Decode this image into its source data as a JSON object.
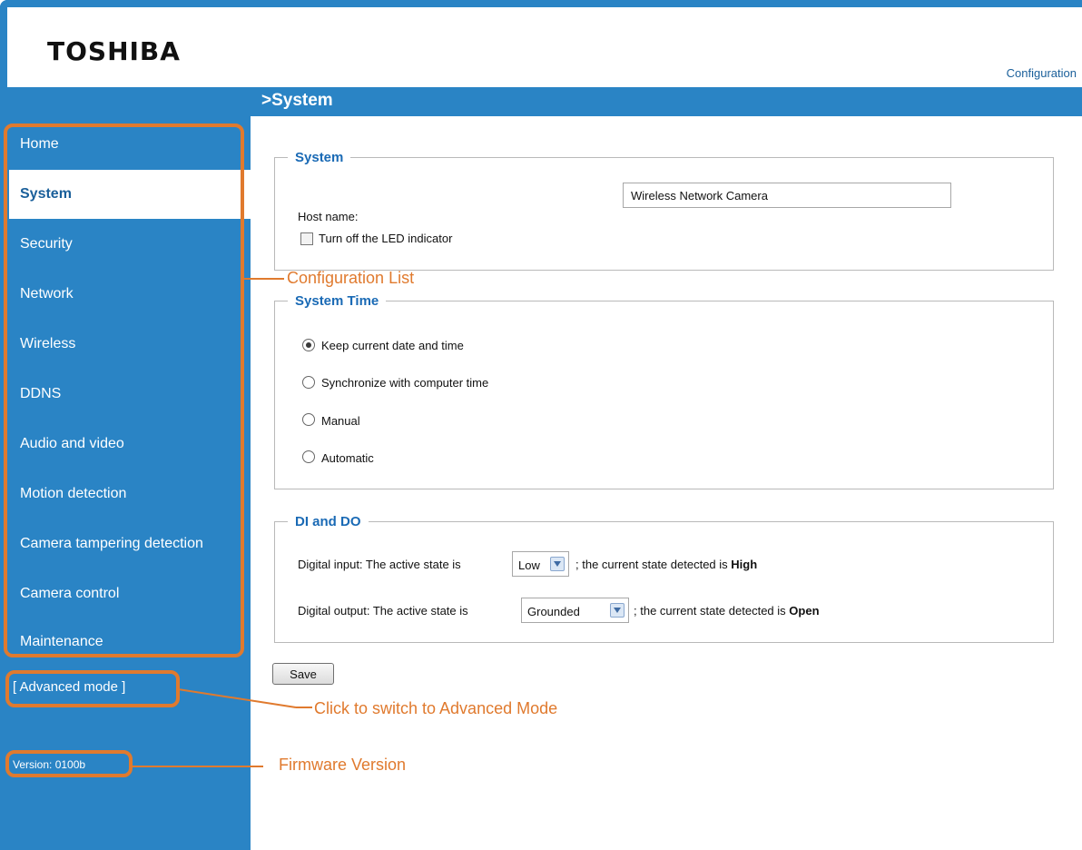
{
  "brand": {
    "logo": "TOSHIBA"
  },
  "header": {
    "config_link": "Configuration",
    "page_title": ">System"
  },
  "sidebar": {
    "items": [
      {
        "label": "Home"
      },
      {
        "label": "System"
      },
      {
        "label": "Security"
      },
      {
        "label": "Network"
      },
      {
        "label": "Wireless"
      },
      {
        "label": "DDNS"
      },
      {
        "label": "Audio and video"
      },
      {
        "label": "Motion detection"
      },
      {
        "label": "Camera tampering detection"
      },
      {
        "label": "Camera control"
      },
      {
        "label": "Maintenance"
      }
    ],
    "active": "System",
    "advanced_mode": "[ Advanced mode ]",
    "version": "Version: 0100b"
  },
  "system_section": {
    "legend": "System",
    "host_label": "Host name:",
    "host_value": "Wireless Network Camera",
    "led_label": "Turn off the LED indicator",
    "led_checked": false
  },
  "time_section": {
    "legend": "System Time",
    "options": [
      {
        "label": "Keep current date and time",
        "selected": true
      },
      {
        "label": "Synchronize with computer time",
        "selected": false
      },
      {
        "label": "Manual",
        "selected": false
      },
      {
        "label": "Automatic",
        "selected": false
      }
    ]
  },
  "dido_section": {
    "legend": "DI and DO",
    "di_prefix": "Digital input: The active state is",
    "di_value": "Low",
    "di_suffix": "; the current state detected is",
    "di_state": "High",
    "do_prefix": "Digital output: The active state is",
    "do_value": "Grounded",
    "do_suffix": "; the current state detected is",
    "do_state": "Open"
  },
  "actions": {
    "save_label": "Save"
  },
  "annotations": {
    "config_list": "Configuration List",
    "advanced_mode": "Click to switch to Advanced Mode",
    "firmware": "Firmware Version"
  },
  "colors": {
    "brand_blue": "#2a84c5",
    "legend_blue": "#1a6ab5",
    "annotation_orange": "#e07a2e"
  }
}
